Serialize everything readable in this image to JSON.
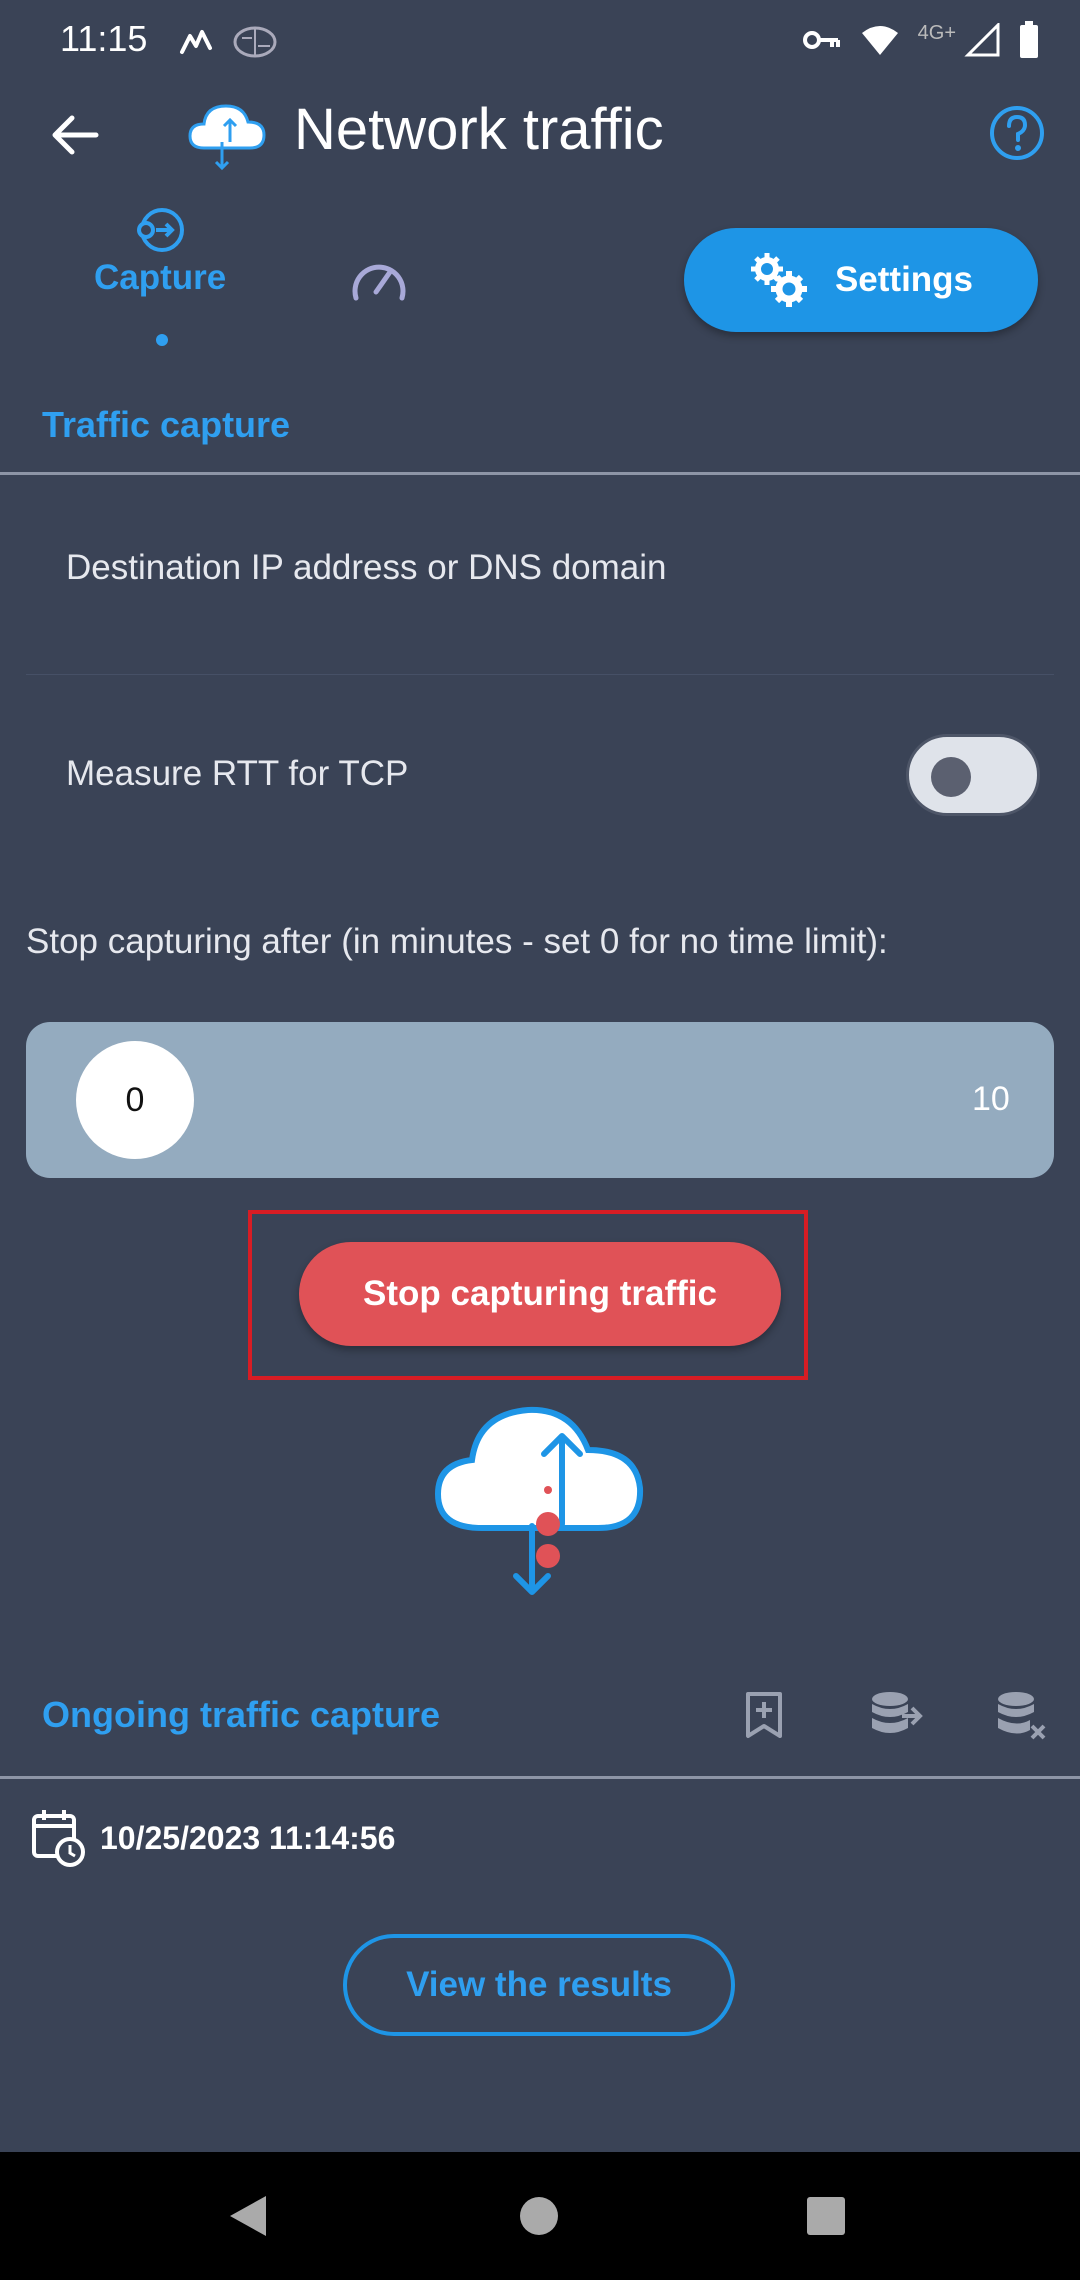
{
  "status_bar": {
    "time": "11:15",
    "network_label": "4G+"
  },
  "app_bar": {
    "title": "Network traffic"
  },
  "tabs": [
    {
      "label": "Capture",
      "active": true,
      "icon": "capture-icon"
    },
    {
      "label": "",
      "active": false,
      "icon": "speedometer-icon"
    }
  ],
  "settings_button": {
    "label": "Settings"
  },
  "traffic_capture": {
    "section_title": "Traffic capture",
    "destination_label": "Destination IP address or DNS domain",
    "measure_rtt_label": "Measure RTT for TCP",
    "measure_rtt_enabled": false,
    "stop_after_label": "Stop capturing after (in minutes - set 0 for no time limit):",
    "slider": {
      "value": "0",
      "max": "10"
    },
    "stop_button_label": "Stop capturing traffic"
  },
  "ongoing_capture": {
    "section_title": "Ongoing traffic capture",
    "start_datetime": "10/25/2023 11:14:56",
    "view_results_label": "View the results"
  },
  "colors": {
    "background": "#3a4356",
    "accent": "#2f9ff0",
    "stop": "#e05257",
    "highlight": "#d81d24"
  }
}
